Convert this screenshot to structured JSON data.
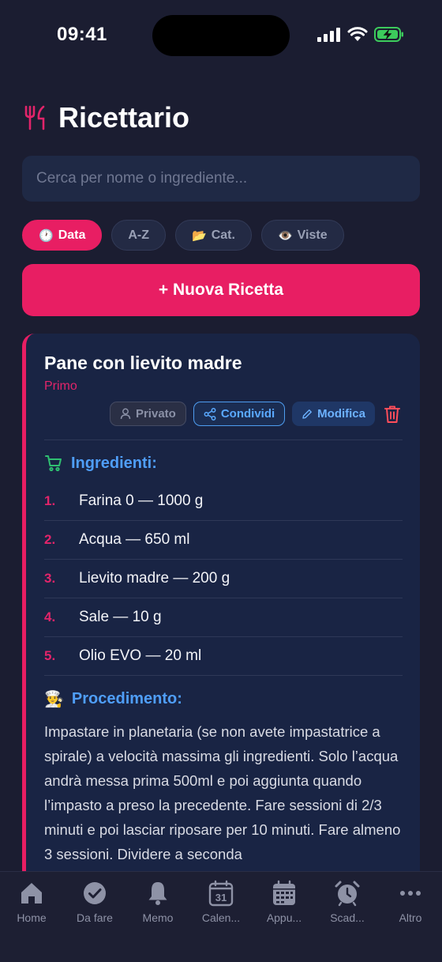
{
  "status": {
    "time": "09:41"
  },
  "header": {
    "title": "Ricettario",
    "icon": "fork-knife-icon"
  },
  "search": {
    "placeholder": "Cerca per nome o ingrediente..."
  },
  "sort_chips": [
    {
      "icon": "🕐",
      "label": "Data",
      "active": true
    },
    {
      "icon": "",
      "label": "A-Z",
      "active": false
    },
    {
      "icon": "📂",
      "label": "Cat.",
      "active": false
    },
    {
      "icon": "👁️",
      "label": "Viste",
      "active": false
    }
  ],
  "new_recipe_label": "+ Nuova Ricetta",
  "recipe": {
    "title": "Pane con lievito madre",
    "category": "Primo",
    "actions": {
      "private": "Privato",
      "share": "Condividi",
      "edit": "Modifica"
    },
    "ingredients_title": "Ingredienti:",
    "ingredients": [
      {
        "num": "1.",
        "text": "Farina 0 — 1000 g"
      },
      {
        "num": "2.",
        "text": "Acqua — 650 ml"
      },
      {
        "num": "3.",
        "text": "Lievito madre — 200 g"
      },
      {
        "num": "4.",
        "text": "Sale — 10 g"
      },
      {
        "num": "5.",
        "text": "Olio EVO — 20 ml"
      }
    ],
    "procedure_title": "Procedimento:",
    "procedure_icon": "👨‍🍳",
    "procedure_text": "Impastare in planetaria (se non avete impastatrice a spirale) a velocità massima gli ingredienti. Solo l’acqua andrà messa prima 500ml e poi aggiunta quando l’impasto a preso la precedente. Fare sessioni di 2/3 minuti e poi lasciar riposare per 10 minuti. Fare almeno 3 sessioni. Dividere a seconda"
  },
  "tabs": [
    {
      "label": "Home",
      "icon": "home-icon"
    },
    {
      "label": "Da fare",
      "icon": "check-circle-icon"
    },
    {
      "label": "Memo",
      "icon": "bell-icon"
    },
    {
      "label": "Calen...",
      "icon": "calendar-icon"
    },
    {
      "label": "Appu...",
      "icon": "calendar-grid-icon"
    },
    {
      "label": "Scad...",
      "icon": "alarm-clock-icon"
    },
    {
      "label": "Altro",
      "icon": "more-icon"
    }
  ],
  "colors": {
    "accent": "#e81e63",
    "background": "#1b1d31",
    "card": "#192444",
    "link": "#4f9ef8"
  }
}
